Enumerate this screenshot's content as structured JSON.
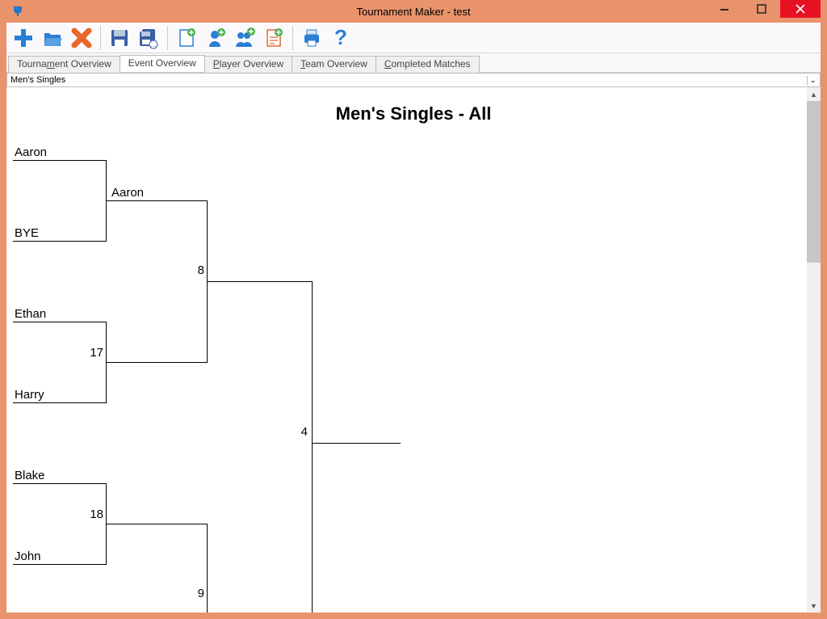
{
  "window": {
    "title": "Tournament Maker - test"
  },
  "tabs": {
    "tournament": "Tournament Overview",
    "event": "Event Overview",
    "player": "Player Overview",
    "team": "Team Overview",
    "completed": "Completed Matches"
  },
  "dropdown": {
    "selected": "Men's Singles"
  },
  "bracket": {
    "title": "Men's Singles - All",
    "r1": {
      "m1": {
        "p1": "Aaron",
        "p2": "BYE"
      },
      "m2": {
        "p1": "Ethan",
        "p2": "Harry",
        "score": "17"
      },
      "m3": {
        "p1": "Blake",
        "p2": "John",
        "score": "18"
      }
    },
    "r2": {
      "m1": {
        "p1": "Aaron",
        "score": "8"
      },
      "m2": {
        "score": "9"
      }
    },
    "r3": {
      "m1": {
        "score": "4"
      }
    }
  },
  "icons": {
    "add": "add",
    "open": "open",
    "delete": "delete",
    "save": "save",
    "saveall": "saveall",
    "newdoc": "newdoc",
    "addplayer": "addplayer",
    "addteam": "addteam",
    "newsheet": "newsheet",
    "print": "print",
    "help": "help"
  }
}
